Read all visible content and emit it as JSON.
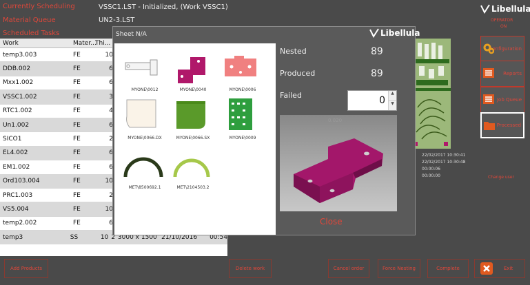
{
  "header": {
    "label1": "Currently Scheduling",
    "label2": "Material Queue",
    "label3": "Scheduled Tasks",
    "current_job": "VSSC1.LST - Initialized, (Work VSSC1)",
    "next_job": "UN2-3.LST"
  },
  "brand": {
    "name": "Libellula",
    "sub1": "OPERATOR",
    "sub2": "ON"
  },
  "worklist": {
    "columns": [
      "Work",
      "Mater...",
      "Thi..."
    ],
    "rows": [
      {
        "work": "temp3.003",
        "mat": "FE",
        "thk": "10"
      },
      {
        "work": "DDB.002",
        "mat": "FE",
        "thk": "6"
      },
      {
        "work": "Mxx1.002",
        "mat": "FE",
        "thk": "6"
      },
      {
        "work": "VSSC1.002",
        "mat": "FE",
        "thk": "3"
      },
      {
        "work": "RTC1.002",
        "mat": "FE",
        "thk": "4"
      },
      {
        "work": "Un1.002",
        "mat": "FE",
        "thk": "6"
      },
      {
        "work": "SICO1",
        "mat": "FE",
        "thk": "2"
      },
      {
        "work": "EL4.002",
        "mat": "FE",
        "thk": "6"
      },
      {
        "work": "EM1.002",
        "mat": "FE",
        "thk": "6"
      },
      {
        "work": "Ord103.004",
        "mat": "FE",
        "thk": "10"
      },
      {
        "work": "PRC1.003",
        "mat": "FE",
        "thk": "2"
      },
      {
        "work": "VS5.004",
        "mat": "FE",
        "thk": "10"
      },
      {
        "work": "temp2.002",
        "mat": "FE",
        "thk": "6"
      },
      {
        "work": "temp3",
        "mat": "SS",
        "thk": "10",
        "extra": "2",
        "size": "3000 x 1500",
        "date": "21/10/2016",
        "time": "00:54"
      }
    ]
  },
  "dialog": {
    "title": "Sheet N/A",
    "brand": "Libellula",
    "nested_label": "Nested",
    "nested_value": "89",
    "produced_label": "Produced",
    "produced_value": "89",
    "failed_label": "Failed",
    "failed_value": "0",
    "preview_label": "0.020",
    "close_label": "Close",
    "thumbnails": [
      {
        "label": "MYONE\\0012"
      },
      {
        "label": "MYONE\\0040"
      },
      {
        "label": "MYONE\\0006"
      },
      {
        "label": "MYONE\\0066.DX"
      },
      {
        "label": "MYONE\\0066.SX"
      },
      {
        "label": "MYONE\\0009"
      },
      {
        "label": "MET\\8500692.1"
      },
      {
        "label": "MET\\2104503.2"
      }
    ]
  },
  "right_panel": {
    "btn1": "Configuration",
    "btn2": "Reports",
    "btn3": "Job Queue",
    "btn4": "Processed",
    "link": "Change user"
  },
  "sheet_info": {
    "line1": "22/02/2017 10:30:41",
    "line2": "22/02/2017 10:30:48",
    "line3": "00:00:06",
    "line4": "00:00:00"
  },
  "bottom": {
    "btn1": "Add Products",
    "btn2": "Delete work",
    "btn3": "Cancel order",
    "btn4": "Force Nesting",
    "btn5": "Complete",
    "exit": "Exit"
  },
  "colors": {
    "accent": "#e0473a",
    "magenta": "#b0186a",
    "green": "#5a9a2a"
  }
}
